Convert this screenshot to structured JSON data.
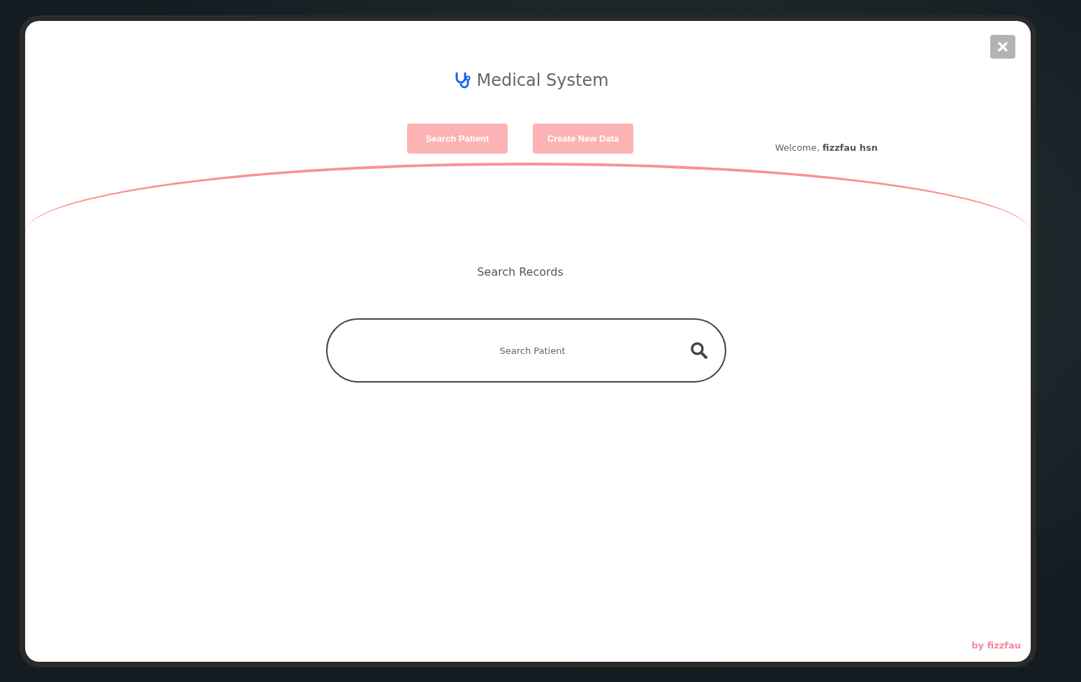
{
  "window": {
    "title": "Medical System"
  },
  "nav_buttons": [
    "Search Patient",
    "Create New Data"
  ],
  "welcome": "Welcome, **fizzfau hsn**",
  "search": {
    "heading": "Search Records",
    "placeholder": "Search Patient"
  },
  "footer": "by **fizzfau**"
}
